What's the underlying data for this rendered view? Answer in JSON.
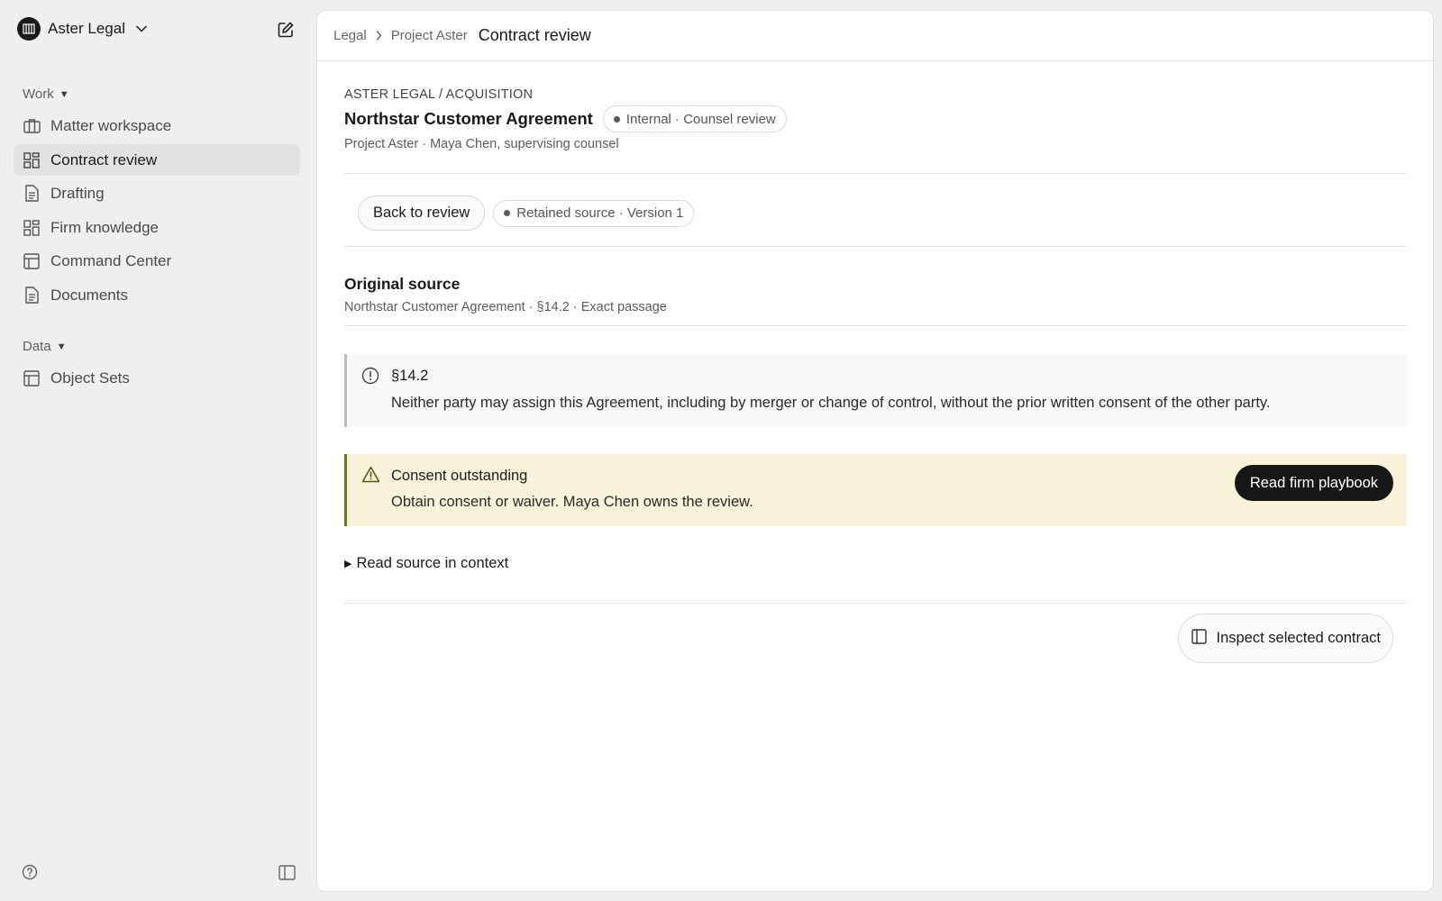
{
  "sidebar": {
    "org_name": "Aster Legal",
    "sections": [
      {
        "label": "Work",
        "items": [
          {
            "label": "Matter workspace",
            "icon": "briefcase-icon"
          },
          {
            "label": "Contract review",
            "icon": "grid-icon",
            "active": true
          },
          {
            "label": "Drafting",
            "icon": "document-icon"
          },
          {
            "label": "Firm knowledge",
            "icon": "grid-icon"
          },
          {
            "label": "Command Center",
            "icon": "table-icon"
          },
          {
            "label": "Documents",
            "icon": "document-icon"
          }
        ]
      },
      {
        "label": "Data",
        "items": [
          {
            "label": "Object Sets",
            "icon": "table-icon"
          }
        ]
      }
    ]
  },
  "breadcrumb": {
    "items": [
      "Legal",
      "Project Aster"
    ],
    "current": "Contract review"
  },
  "header": {
    "eyebrow": "ASTER LEGAL / ACQUISITION",
    "title": "Northstar Customer Agreement",
    "status_pill": "Internal · Counsel review",
    "subline": "Project Aster · Maya Chen, supervising counsel"
  },
  "actions": {
    "back_label": "Back to review",
    "source_pill": "Retained source · Version 1"
  },
  "source": {
    "title": "Original source",
    "subtitle": "Northstar Customer Agreement · §14.2 · Exact passage",
    "clause_ref": "§14.2",
    "clause_text": "Neither party may assign this Agreement, including by merger or change of control, without the prior written consent of the other party."
  },
  "alert": {
    "title": "Consent outstanding",
    "text": "Obtain consent or waiver. Maya Chen owns the review.",
    "button_label": "Read firm playbook"
  },
  "disclosure_label": "Read source in context",
  "inspect_label": "Inspect selected contract",
  "colors": {
    "sidebar_bg": "#efefed",
    "alert_bg": "#f7f3d8",
    "alert_border": "#7a7020",
    "primary_button": "#171717"
  }
}
